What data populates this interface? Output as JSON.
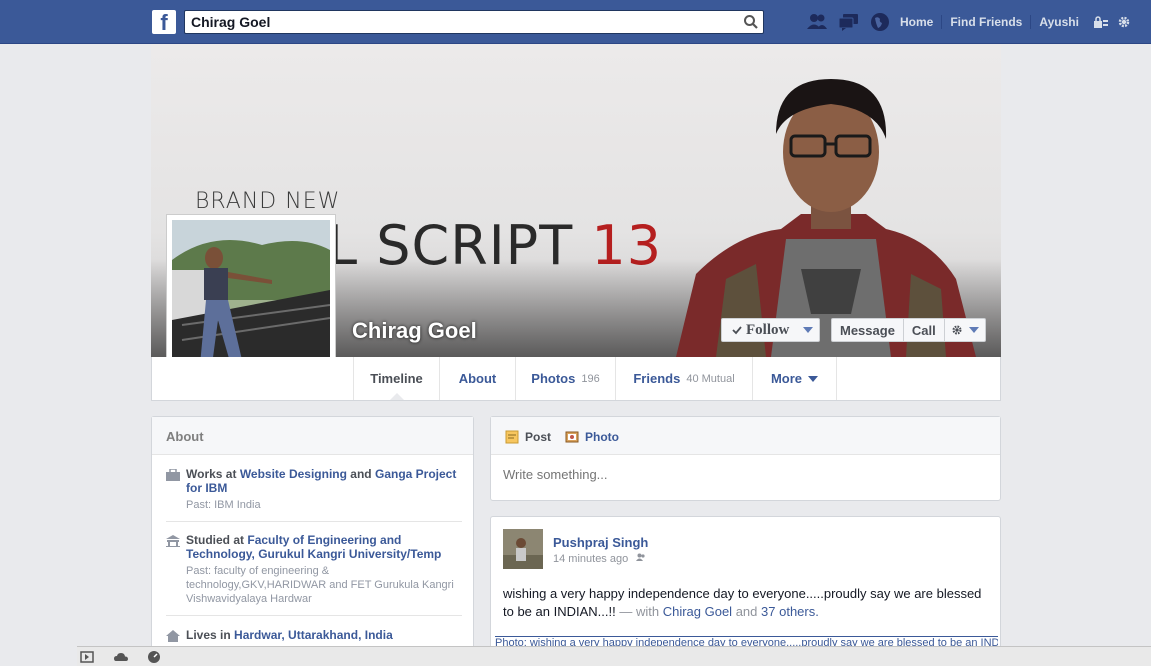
{
  "topbar": {
    "logo_letter": "f",
    "search_value": "Chirag Goel",
    "nav": {
      "home": "Home",
      "find_friends": "Find Friends",
      "user": "Ayushi"
    },
    "colors": {
      "brand": "#3b5998"
    }
  },
  "cover": {
    "brand_new": "BRAND NEW",
    "script": "L SCRIPT",
    "script_num": "13"
  },
  "profile": {
    "name": "Chirag Goel",
    "follow_label": "Follow",
    "message_label": "Message",
    "call_label": "Call"
  },
  "tabs": {
    "timeline": "Timeline",
    "about": "About",
    "photos": "Photos",
    "photos_count": "196",
    "friends": "Friends",
    "friends_count": "40 Mutual",
    "more": "More"
  },
  "about": {
    "title": "About",
    "work": {
      "prefix": "Works at",
      "place1": "Website Designing",
      "and": "and",
      "place2": "Ganga Project for IBM",
      "past": "Past: IBM India"
    },
    "study": {
      "prefix": "Studied at",
      "place": "Faculty of Engineering and Technology, Gurukul Kangri University/Temp",
      "past": "Past: faculty of engineering & technology,GKV,HARIDWAR and FET Gurukula Kangri Vishwavidyalaya Hardwar"
    },
    "lives": {
      "prefix": "Lives in",
      "place": "Hardwar, Uttarakhand, India"
    }
  },
  "composer": {
    "post_label": "Post",
    "photo_label": "Photo",
    "placeholder": "Write something..."
  },
  "story": {
    "author": "Pushpraj Singh",
    "time": "14 minutes ago",
    "text": "wishing a very happy independence day to everyone.....proudly say we are blessed to be an INDIAN...!!",
    "with_prefix": "— with",
    "with_name": "Chirag Goel",
    "and": "and",
    "others": "37 others.",
    "photo_link": "Photo: wishing a very happy independence day to everyone.....proudly say we are blessed to be an INDIAN...!!"
  }
}
